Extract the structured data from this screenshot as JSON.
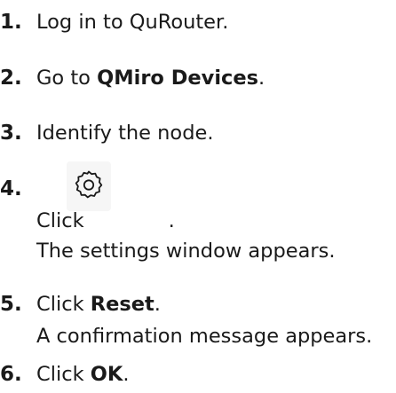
{
  "steps": [
    {
      "number": "1.",
      "text": "Log in to QuRouter."
    },
    {
      "number": "2.",
      "text_before": "Go to ",
      "bold": "QMiro Devices",
      "text_after": "."
    },
    {
      "number": "3.",
      "text": "Identify the node."
    },
    {
      "number": "4.",
      "text_before": "Click",
      "icon": "gear-icon",
      "text_after": ".",
      "result": "The settings window appears."
    },
    {
      "number": "5.",
      "text_before": "Click ",
      "bold": "Reset",
      "text_after": ".",
      "result": "A confirmation message appears."
    },
    {
      "number": "6.",
      "text_before": "Click ",
      "bold": "OK",
      "text_after": "."
    }
  ]
}
